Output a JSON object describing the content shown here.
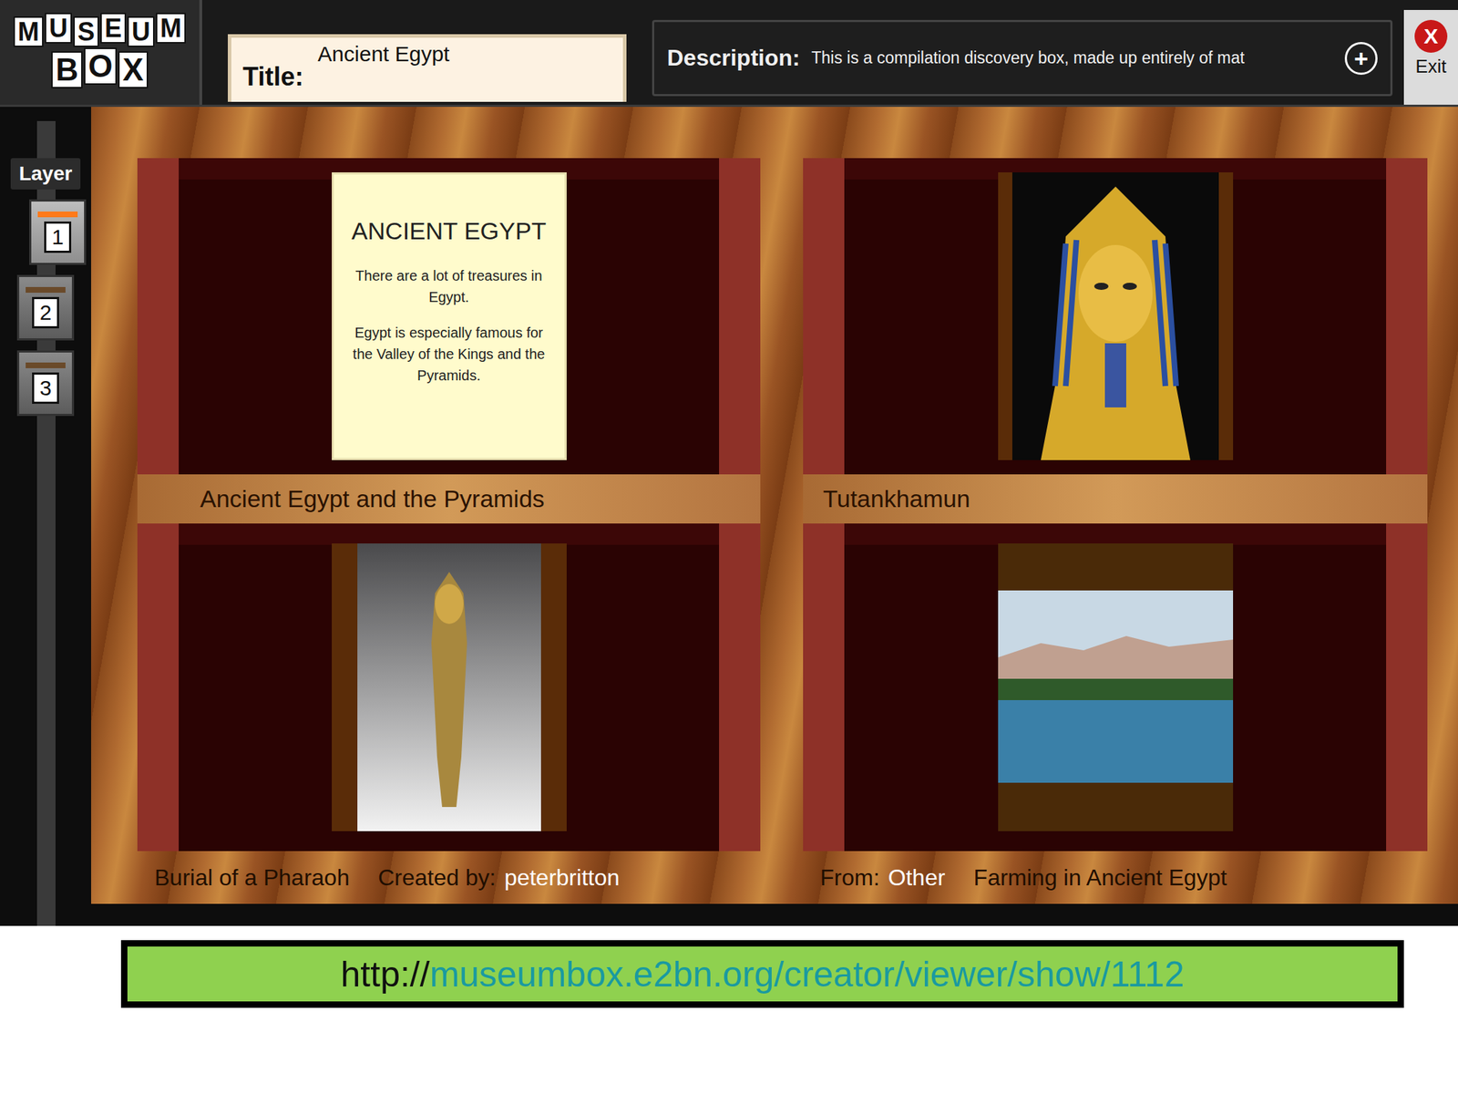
{
  "logo": {
    "rows": [
      [
        "M",
        "U",
        "S",
        "E",
        "U",
        "M"
      ],
      [
        "B",
        "O",
        "X"
      ]
    ]
  },
  "title": {
    "label": "Title:",
    "value": "Ancient Egypt"
  },
  "description": {
    "label": "Description:",
    "value": "This is a compilation discovery box, made up entirely of mat",
    "expand_icon": "+"
  },
  "exit": {
    "icon": "X",
    "label": "Exit"
  },
  "layers": {
    "label": "Layer",
    "items": [
      {
        "label": "1",
        "selected": true
      },
      {
        "label": "2",
        "selected": false
      },
      {
        "label": "3",
        "selected": false
      }
    ]
  },
  "compartments": [
    {
      "kind": "note",
      "caption": "Ancient Egypt and the Pyramids",
      "heading": "ANCIENT EGYPT",
      "paragraphs": [
        "There are a lot of treasures in Egypt.",
        "Egypt is especially famous for the Valley of the Kings and the Pyramids."
      ]
    },
    {
      "kind": "mask",
      "caption": "Tutankhamun"
    },
    {
      "kind": "coffin",
      "caption": "Burial of a Pharaoh"
    },
    {
      "kind": "river",
      "caption": "Farming in Ancient Egypt"
    }
  ],
  "footer": {
    "created_label": "Created by:",
    "creator": "peterbritton",
    "from_label": "From:",
    "from": "Other"
  },
  "link": {
    "prefix": "http://",
    "path": "museumbox.e2bn.org/creator/viewer/show/1112"
  }
}
